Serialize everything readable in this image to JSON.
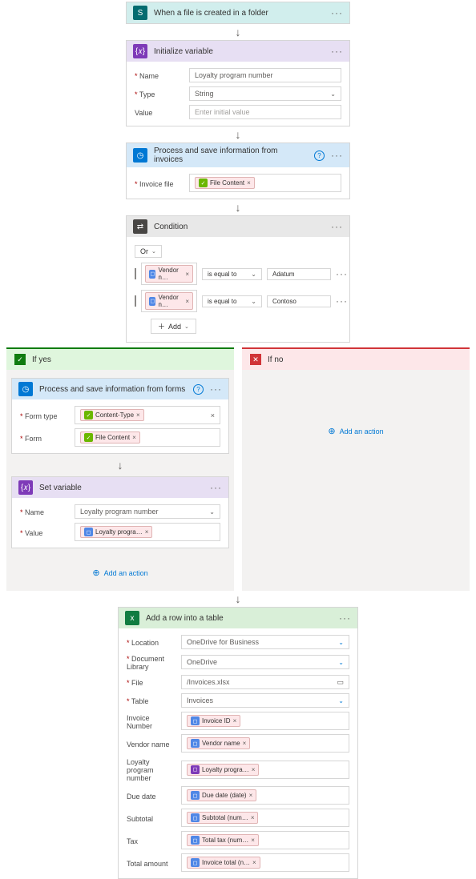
{
  "trigger": {
    "title": "When a file is created in a folder"
  },
  "init_var": {
    "title": "Initialize variable",
    "name_label": "Name",
    "name_value": "Loyalty program number",
    "type_label": "Type",
    "type_value": "String",
    "value_label": "Value",
    "value_placeholder": "Enter initial value"
  },
  "process_inv": {
    "title": "Process and save information from invoices",
    "file_label": "Invoice file",
    "token": "File Content"
  },
  "condition": {
    "title": "Condition",
    "logic": "Or",
    "operator": "is equal to",
    "rows": [
      {
        "field": "Vendor n…",
        "value": "Adatum"
      },
      {
        "field": "Vendor n…",
        "value": "Contoso"
      }
    ],
    "add": "Add"
  },
  "if_yes": "If yes",
  "if_no": "If no",
  "add_action": "Add an action",
  "process_forms": {
    "title": "Process and save information from  forms",
    "form_type_label": "Form type",
    "form_type_token": "Content-Type",
    "form_label": "Form",
    "form_token": "File Content"
  },
  "set_var": {
    "title": "Set variable",
    "name_label": "Name",
    "name_value": "Loyalty program number",
    "value_label": "Value",
    "value_token": "Loyalty progra…"
  },
  "excel": {
    "title": "Add a row into a table",
    "location_label": "Location",
    "location_value": "OneDrive for Business",
    "doclib_label": "Document Library",
    "doclib_value": "OneDrive",
    "file_label": "File",
    "file_value": "/Invoices.xlsx",
    "table_label": "Table",
    "table_value": "Invoices",
    "map": [
      {
        "label": "Invoice Number",
        "token": "Invoice ID",
        "color": "blue"
      },
      {
        "label": "Vendor name",
        "token": "Vendor name",
        "color": "blue"
      },
      {
        "label": "Loyalty program number",
        "token": "Loyalty progra…",
        "color": "purple"
      },
      {
        "label": "Due date",
        "token": "Due date (date)",
        "color": "blue"
      },
      {
        "label": "Subtotal",
        "token": "Subtotal (num…",
        "color": "blue"
      },
      {
        "label": "Tax",
        "token": "Total tax (num…",
        "color": "blue"
      },
      {
        "label": "Total amount",
        "token": "Invoice total (n…",
        "color": "blue"
      }
    ]
  }
}
